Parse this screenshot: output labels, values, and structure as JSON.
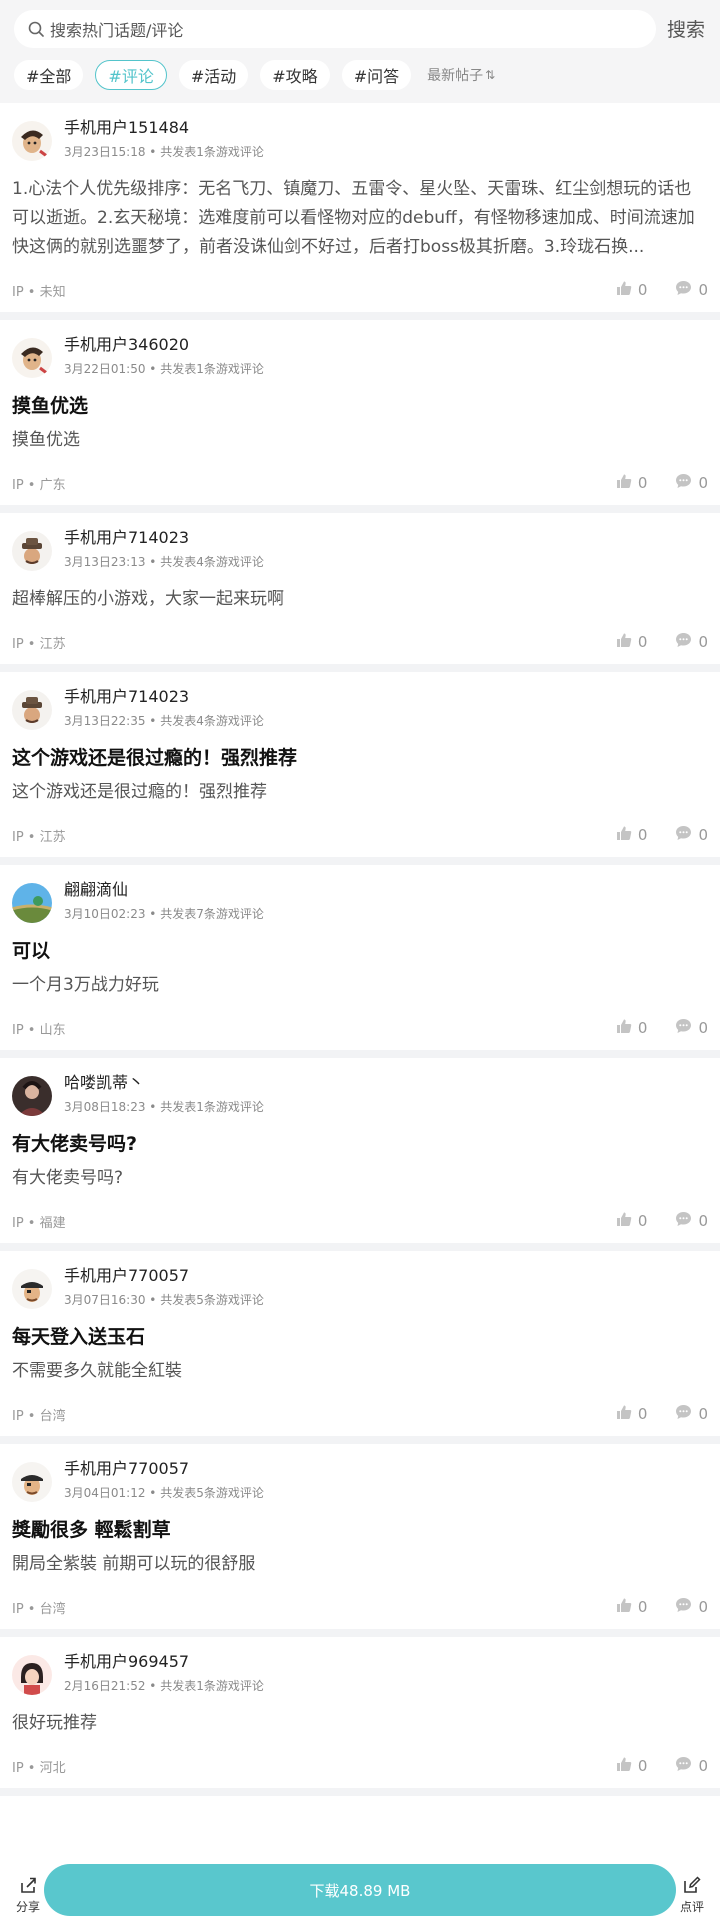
{
  "search": {
    "placeholder": "搜索热门话题/评论",
    "button": "搜索"
  },
  "tabs": [
    {
      "label": "#全部"
    },
    {
      "label": "#评论"
    },
    {
      "label": "#活动"
    },
    {
      "label": "#攻略"
    },
    {
      "label": "#问答"
    }
  ],
  "sort": {
    "label": "最新帖子"
  },
  "accent_color": "#53c4cb",
  "posts": [
    {
      "user": "手机用户151484",
      "meta": "3月23日15:18 • 共发表1条游戏评论",
      "title": "",
      "body": "1.心法个人优先级排序：无名飞刀、镇魔刀、五雷令、星火坠、天雷珠、红尘剑想玩的话也可以逝逝。2.玄天秘境：选难度前可以看怪物对应的debuff，有怪物移速加成、时间流速加快这俩的就别选噩梦了，前者没诛仙剑不好过，后者打boss极其折磨。3.玲珑石换...",
      "ip": "IP • 未知",
      "likes": "0",
      "comments": "0",
      "avatar": "warrior"
    },
    {
      "user": "手机用户346020",
      "meta": "3月22日01:50 • 共发表1条游戏评论",
      "title": "摸鱼优选",
      "body": "摸鱼优选",
      "ip": "IP • 广东",
      "likes": "0",
      "comments": "0",
      "avatar": "warrior"
    },
    {
      "user": "手机用户714023",
      "meta": "3月13日23:13 • 共发表4条游戏评论",
      "title": "",
      "body": "超棒解压的小游戏，大家一起来玩啊",
      "ip": "IP • 江苏",
      "likes": "0",
      "comments": "0",
      "avatar": "hat"
    },
    {
      "user": "手机用户714023",
      "meta": "3月13日22:35 • 共发表4条游戏评论",
      "title": "这个游戏还是很过瘾的！强烈推荐",
      "body": "这个游戏还是很过瘾的！强烈推荐",
      "ip": "IP • 江苏",
      "likes": "0",
      "comments": "0",
      "avatar": "hat"
    },
    {
      "user": "翩翩滴仙",
      "meta": "3月10日02:23 • 共发表7条游戏评论",
      "title": "可以",
      "body": "一个月3万战力好玩",
      "ip": "IP • 山东",
      "likes": "0",
      "comments": "0",
      "avatar": "landscape"
    },
    {
      "user": "哈喽凯蒂丶",
      "meta": "3月08日18:23 • 共发表1条游戏评论",
      "title": "有大佬卖号吗?",
      "body": "有大佬卖号吗?",
      "ip": "IP • 福建",
      "likes": "0",
      "comments": "0",
      "avatar": "photo"
    },
    {
      "user": "手机用户770057",
      "meta": "3月07日16:30 • 共发表5条游戏评论",
      "title": "每天登入送玉石",
      "body": "不需要多久就能全紅裝",
      "ip": "IP • 台湾",
      "likes": "0",
      "comments": "0",
      "avatar": "pirate"
    },
    {
      "user": "手机用户770057",
      "meta": "3月04日01:12 • 共发表5条游戏评论",
      "title": "獎勵很多 輕鬆割草",
      "body": "開局全紫裝 前期可以玩的很舒服",
      "ip": "IP • 台湾",
      "likes": "0",
      "comments": "0",
      "avatar": "pirate"
    },
    {
      "user": "手机用户969457",
      "meta": "2月16日21:52 • 共发表1条游戏评论",
      "title": "",
      "body": "很好玩推荐",
      "ip": "IP • 河北",
      "likes": "0",
      "comments": "0",
      "avatar": "girl"
    }
  ],
  "bottom": {
    "share": "分享",
    "download": "下载48.89 MB",
    "review": "点评"
  }
}
